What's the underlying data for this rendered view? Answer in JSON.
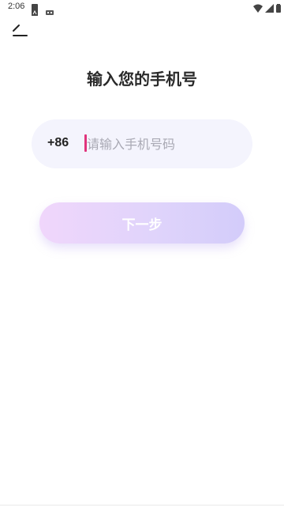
{
  "status_bar": {
    "time": "2:06",
    "left_icons": [
      "notification-a-icon",
      "notification-b-icon"
    ],
    "right_icons": [
      "wifi-icon",
      "signal-icon",
      "battery-icon"
    ]
  },
  "nav": {
    "back_icon": "back-arrow-icon"
  },
  "page": {
    "title": "输入您的手机号"
  },
  "phone_field": {
    "country_code": "+86",
    "placeholder": "请输入手机号码",
    "value": "",
    "caret_color": "#e0337c"
  },
  "next_button": {
    "label": "下一步",
    "gradient_start": "#f0d6fb",
    "gradient_end": "#d3ccfa",
    "enabled": false
  },
  "colors": {
    "background": "#ffffff",
    "field_background": "#f4f4fd",
    "title_color": "#2a2a2a"
  }
}
